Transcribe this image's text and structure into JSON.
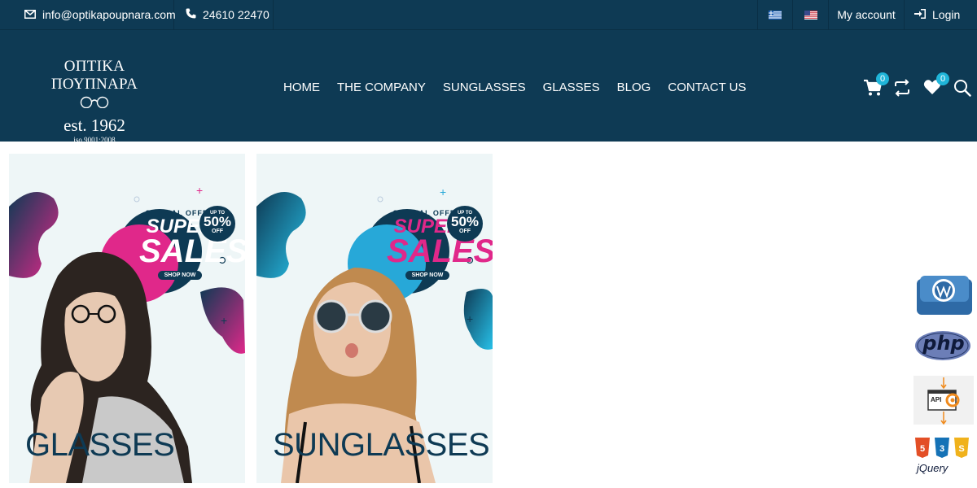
{
  "topbar": {
    "email": "info@optikapoupnara.com",
    "phone": "24610 22470",
    "account": "My account",
    "login": "Login"
  },
  "logo": {
    "name": "ΟΠΤΙΚΑ ΠΟΥΠΝΑΡΑ",
    "est": "est. 1962",
    "iso": "iso 9001:2008"
  },
  "nav": [
    "HOME",
    "THE COMPANY",
    "SUNGLASSES",
    "GLASSES",
    "BLOG",
    "CONTACT US"
  ],
  "header_icons": {
    "cart_count": "0",
    "wishlist_count": "0"
  },
  "cards": [
    {
      "label": "GLASSES",
      "promo": {
        "special": "SPECIAL OFFER",
        "super": "SUPER",
        "sales": "SALES",
        "shop": "SHOP NOW",
        "upto": "UP TO",
        "percent": "50%",
        "off": "OFF"
      }
    },
    {
      "label": "SUNGLASSES",
      "promo": {
        "special": "SPECIAL OFFER",
        "super": "SUPER",
        "sales": "SALES",
        "shop": "SHOP NOW",
        "upto": "UP TO",
        "percent": "50%",
        "off": "OFF"
      }
    }
  ],
  "side_badges": {
    "php": "php",
    "api": "API",
    "jquery": "jQuery"
  },
  "colors": {
    "navy": "#0e3a54",
    "accent": "#1fb5d9",
    "pink": "#d6287a"
  }
}
